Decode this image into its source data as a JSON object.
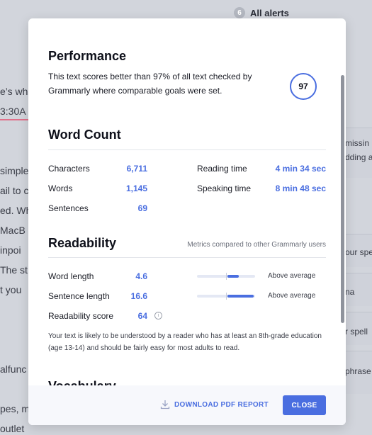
{
  "background": {
    "all_alerts_count": "6",
    "all_alerts_label": "All alerts",
    "left_fragments": [
      "e’s wh",
      "3:30A",
      "simple",
      "ail to c",
      "ed. Wh",
      "MacB",
      "inpoi",
      "The st",
      "t you",
      "alfunc",
      "pes, m",
      "outlet"
    ],
    "right_fragments": [
      "missin",
      "dding a",
      "our spe",
      "na",
      "r spell",
      "phrase"
    ]
  },
  "modal": {
    "performance": {
      "heading": "Performance",
      "text": "This text scores better than 97% of all text checked by Grammarly where comparable goals were set.",
      "score": "97"
    },
    "word_count": {
      "heading": "Word Count",
      "left": [
        {
          "label": "Characters",
          "value": "6,711"
        },
        {
          "label": "Words",
          "value": "1,145"
        },
        {
          "label": "Sentences",
          "value": "69"
        }
      ],
      "right": [
        {
          "label": "Reading time",
          "value": "4 min 34 sec"
        },
        {
          "label": "Speaking time",
          "value": "8 min 48 sec"
        }
      ]
    },
    "readability": {
      "heading": "Readability",
      "note": "Metrics compared to other Grammarly users",
      "metrics": [
        {
          "label": "Word length",
          "value": "4.6",
          "comparison": "Above average",
          "bar_fill_start": 0.52,
          "bar_fill_end": 0.72
        },
        {
          "label": "Sentence length",
          "value": "16.6",
          "comparison": "Above average",
          "bar_fill_start": 0.52,
          "bar_fill_end": 0.97
        }
      ],
      "score_label": "Readability score",
      "score_value": "64",
      "info_icon": "info-icon",
      "description": "Your text is likely to be understood by a reader who has at least an 8th-grade education (age 13-14) and should be fairly easy for most adults to read."
    },
    "next_heading_partial": "Vocabulary",
    "footer": {
      "download_label": "DOWNLOAD PDF REPORT",
      "download_icon": "download-icon",
      "close_label": "CLOSE"
    }
  },
  "colors": {
    "accent": "#4a6ee0",
    "background": "#d2d5dc"
  }
}
